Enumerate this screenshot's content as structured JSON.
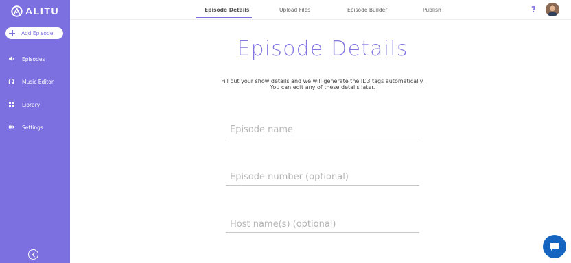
{
  "brand": {
    "name": "ALITU"
  },
  "sidebar": {
    "add_button": "Add Episode",
    "items": [
      {
        "label": "Episodes",
        "icon": "speaker-icon"
      },
      {
        "label": "Music Editor",
        "icon": "headphones-icon"
      },
      {
        "label": "Library",
        "icon": "grid-icon"
      },
      {
        "label": "Settings",
        "icon": "gear-icon"
      }
    ]
  },
  "tabs": [
    {
      "label": "Episode Details",
      "active": true
    },
    {
      "label": "Upload Files",
      "active": false
    },
    {
      "label": "Episode Builder",
      "active": false
    },
    {
      "label": "Publish",
      "active": false
    }
  ],
  "header": {
    "help_label": "?"
  },
  "main": {
    "title": "Episode Details",
    "subtitle": "Fill out your show details and we will generate the ID3 tags automatically. You can edit any of these details later.",
    "fields": [
      {
        "placeholder": "Episode name",
        "value": ""
      },
      {
        "placeholder": "Episode number (optional)",
        "value": ""
      },
      {
        "placeholder": "Host name(s) (optional)",
        "value": ""
      }
    ]
  },
  "colors": {
    "accent": "#7c6fe0",
    "chat": "#1565c0"
  }
}
